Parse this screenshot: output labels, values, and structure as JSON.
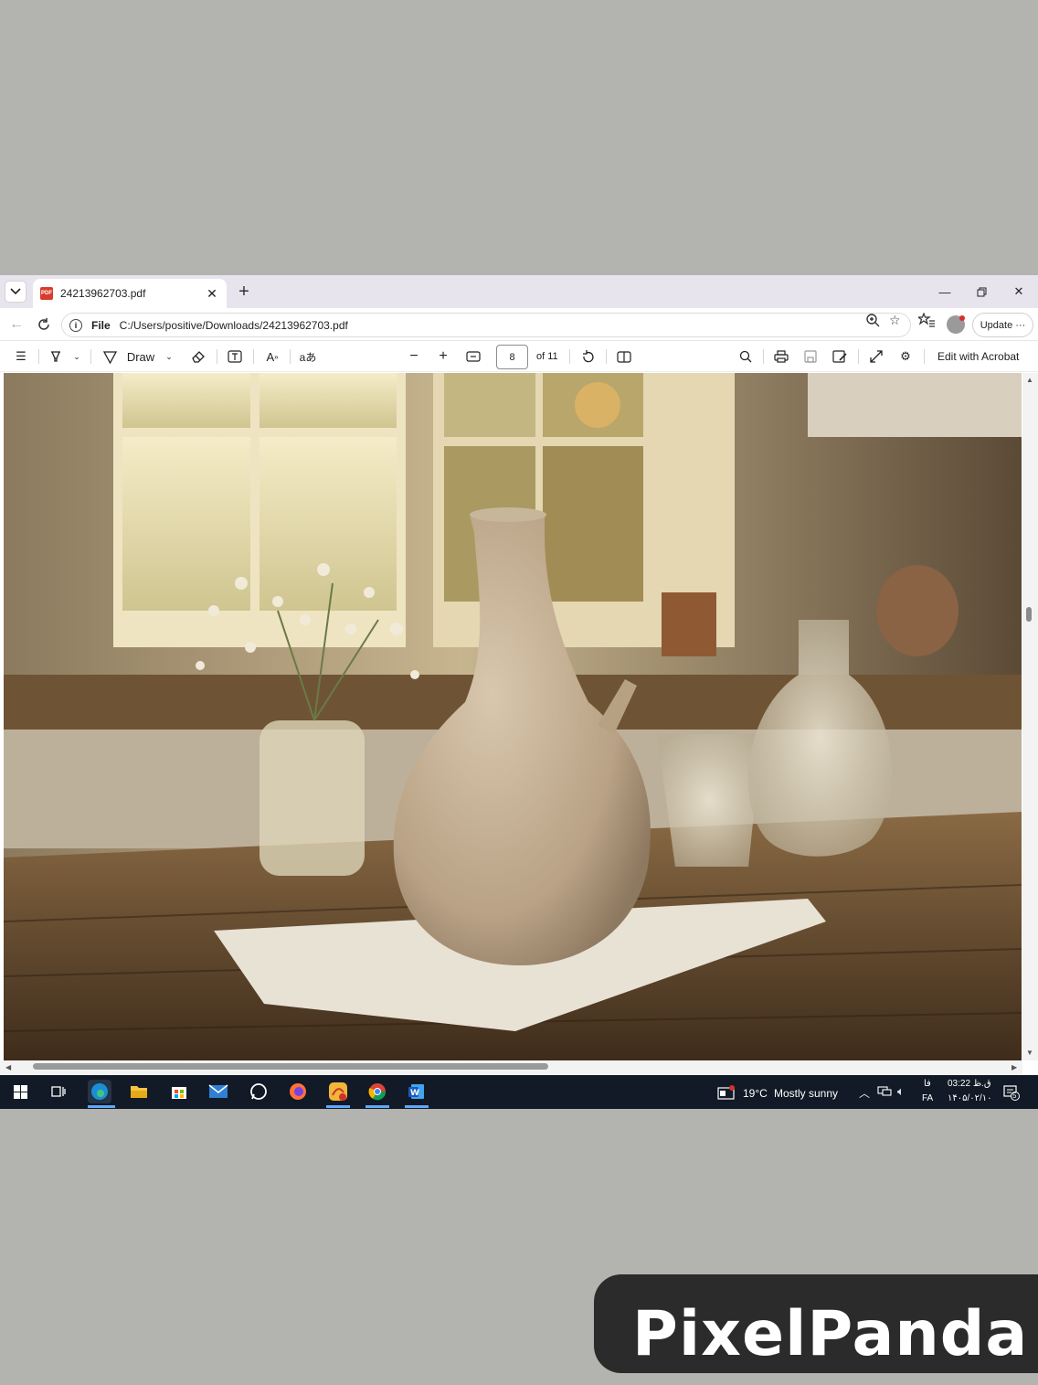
{
  "browser": {
    "tab": {
      "title": "24213962703.pdf",
      "icon": "pdf-file-icon",
      "badge": "PDF"
    },
    "address": {
      "scheme": "File",
      "path": "C:/Users/positive/Downloads/24213962703.pdf"
    },
    "update_label": "Update",
    "update_more": "···"
  },
  "pdf_toolbar": {
    "draw_label": "Draw",
    "current_page": "8",
    "page_count": "of 11",
    "edit_with_acrobat": "Edit with Acrobat",
    "read_aloud": "aあ"
  },
  "taskbar": {
    "weather_temp": "19°C",
    "weather_text": "Mostly sunny",
    "lang_top": "فا",
    "lang_bottom": "FA",
    "time": "03:22 ق.ظ",
    "date": "۱۴۰۵/۰۲/۱۰",
    "notifications": "5",
    "apps": [
      "windows",
      "task-view",
      "edge",
      "file-explorer",
      "store",
      "mail",
      "whatsapp",
      "firefox",
      "photos",
      "chrome",
      "word"
    ]
  },
  "watermark": {
    "text": "PixelPanda"
  }
}
